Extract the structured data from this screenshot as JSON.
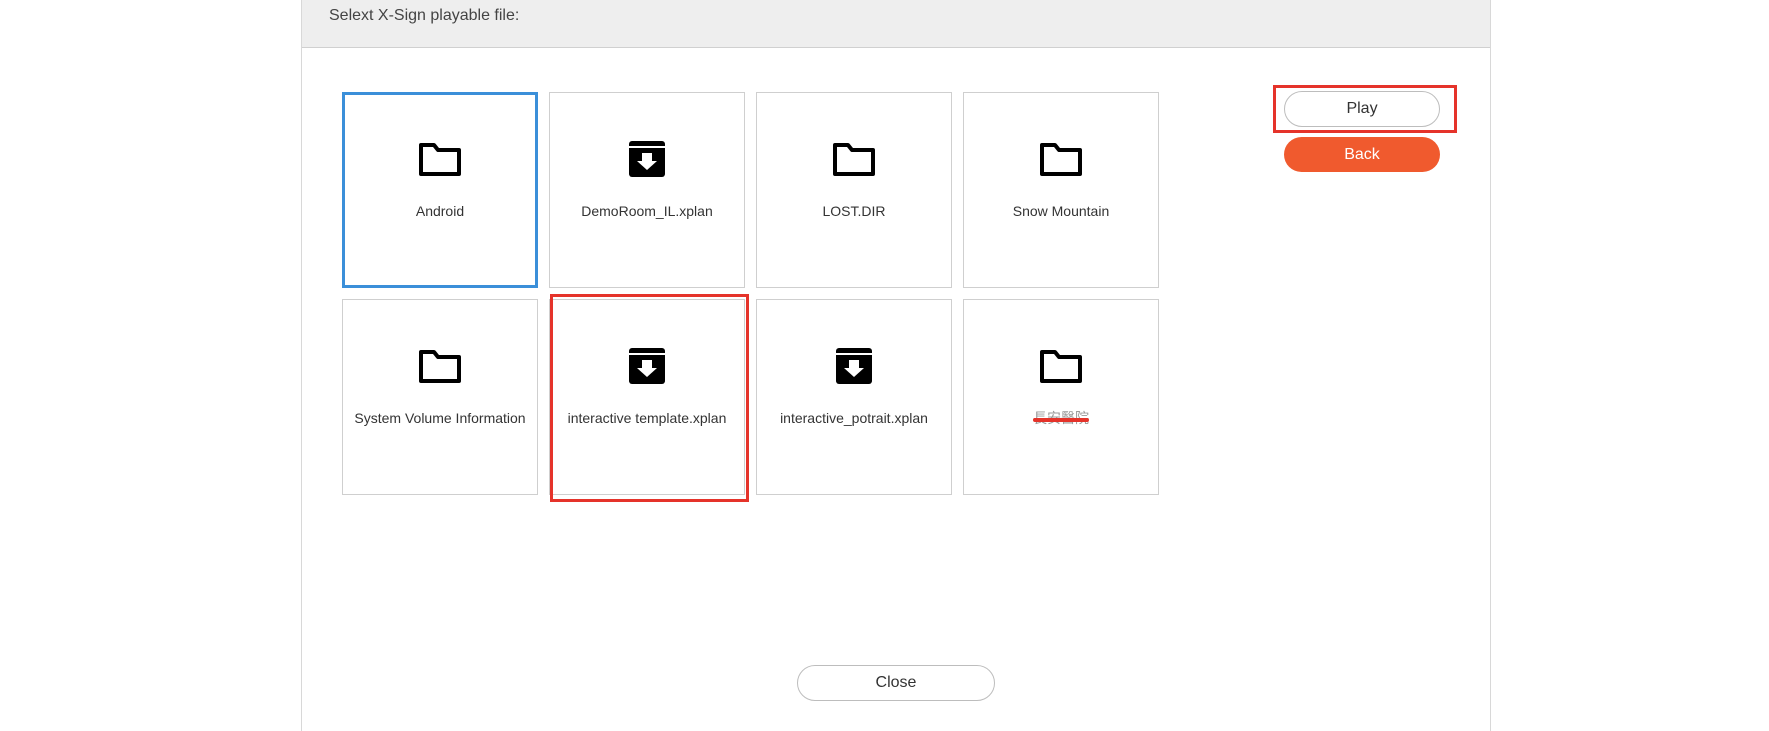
{
  "dialog": {
    "title": "Selext X-Sign playable file:"
  },
  "files": [
    {
      "name": "Android",
      "icon": "folder-icon",
      "type": "folder"
    },
    {
      "name": "DemoRoom_IL.xplan",
      "icon": "download-box-icon",
      "type": "xplan"
    },
    {
      "name": "LOST.DIR",
      "icon": "folder-icon",
      "type": "folder"
    },
    {
      "name": "Snow Mountain",
      "icon": "folder-icon",
      "type": "folder"
    },
    {
      "name": "System Volume Information",
      "icon": "folder-icon",
      "type": "folder"
    },
    {
      "name": "interactive template.xplan",
      "icon": "download-box-icon",
      "type": "xplan"
    },
    {
      "name": "interactive_potrait.xplan",
      "icon": "download-box-icon",
      "type": "xplan"
    },
    {
      "name": "長安醫院",
      "icon": "folder-icon",
      "type": "folder",
      "redacted": true
    }
  ],
  "actions": {
    "play_label": "Play",
    "back_label": "Back",
    "close_label": "Close"
  },
  "colors": {
    "accent_orange": "#f05a2e",
    "focus_blue": "#3b8fd9",
    "highlight_red": "#e5332a",
    "header_gray": "#eeeeee"
  }
}
